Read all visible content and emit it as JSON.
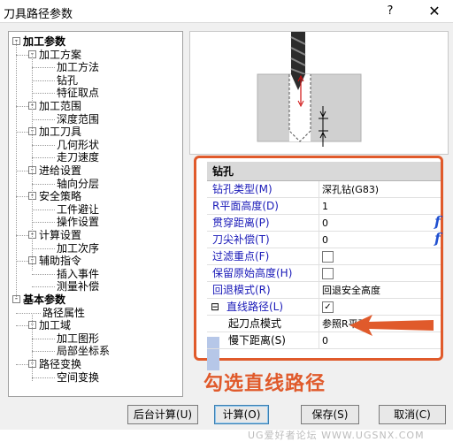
{
  "window": {
    "title": "刀具路径参数",
    "help_label": "?",
    "close_label": "✕"
  },
  "tree": {
    "items": [
      {
        "label": "加工参数",
        "level": 0,
        "bold": true,
        "box": "-"
      },
      {
        "label": "加工方案",
        "level": 1,
        "box": "-"
      },
      {
        "label": "加工方法",
        "level": 2
      },
      {
        "label": "钻孔",
        "level": 2
      },
      {
        "label": "特征取点",
        "level": 2
      },
      {
        "label": "加工范围",
        "level": 1,
        "box": "-"
      },
      {
        "label": "深度范围",
        "level": 2
      },
      {
        "label": "加工刀具",
        "level": 1,
        "box": "-"
      },
      {
        "label": "几何形状",
        "level": 2
      },
      {
        "label": "走刀速度",
        "level": 2
      },
      {
        "label": "进给设置",
        "level": 1,
        "box": "-"
      },
      {
        "label": "轴向分层",
        "level": 2
      },
      {
        "label": "安全策略",
        "level": 1,
        "box": "-"
      },
      {
        "label": "工件避让",
        "level": 2
      },
      {
        "label": "操作设置",
        "level": 2
      },
      {
        "label": "计算设置",
        "level": 1,
        "box": "-"
      },
      {
        "label": "加工次序",
        "level": 2
      },
      {
        "label": "辅助指令",
        "level": 1,
        "box": "-"
      },
      {
        "label": "插入事件",
        "level": 2
      },
      {
        "label": "测量补偿",
        "level": 2
      },
      {
        "label": "基本参数",
        "level": 0,
        "bold": true,
        "box": "-"
      },
      {
        "label": "路径属性",
        "level": 1
      },
      {
        "label": "加工域",
        "level": 1,
        "box": "-"
      },
      {
        "label": "加工图形",
        "level": 2
      },
      {
        "label": "局部坐标系",
        "level": 2
      },
      {
        "label": "路径变换",
        "level": 1,
        "box": "-"
      },
      {
        "label": "空间变换",
        "level": 2
      }
    ]
  },
  "grid": {
    "header": "钻孔",
    "rows": [
      {
        "label": "钻孔类型(M)",
        "value": "深孔钻(G83)",
        "kind": "text"
      },
      {
        "label": "R平面高度(D)",
        "value": "1",
        "kind": "text"
      },
      {
        "label": "贯穿距离(P)",
        "value": "0",
        "kind": "text",
        "side": "f"
      },
      {
        "label": "刀尖补偿(T)",
        "value": "0",
        "kind": "text",
        "side": "f"
      },
      {
        "label": "过滤重点(F)",
        "value": "",
        "kind": "checkbox",
        "checked": false
      },
      {
        "label": "保留原始高度(H)",
        "value": "",
        "kind": "checkbox",
        "checked": false
      },
      {
        "label": "回退模式(R)",
        "value": "回退安全高度",
        "kind": "text"
      },
      {
        "label": "直线路径(L)",
        "value": "",
        "kind": "checkbox",
        "checked": true,
        "expander": "⊟"
      },
      {
        "label": "起刀点模式",
        "value": "参照R平面",
        "kind": "text",
        "sub": true
      },
      {
        "label": "慢下距离(S)",
        "value": "0",
        "kind": "text",
        "sub": true
      }
    ]
  },
  "annotation": "勾选直线路径",
  "buttons": {
    "background_calc": "后台计算(U)",
    "calc": "计算(O)",
    "save": "保存(S)",
    "cancel": "取消(C)"
  },
  "watermark": "UG爱好者论坛  WWW.UGSNX.COM",
  "colors": {
    "highlight": "#e05a2b",
    "link_text": "#1a1ab8"
  }
}
